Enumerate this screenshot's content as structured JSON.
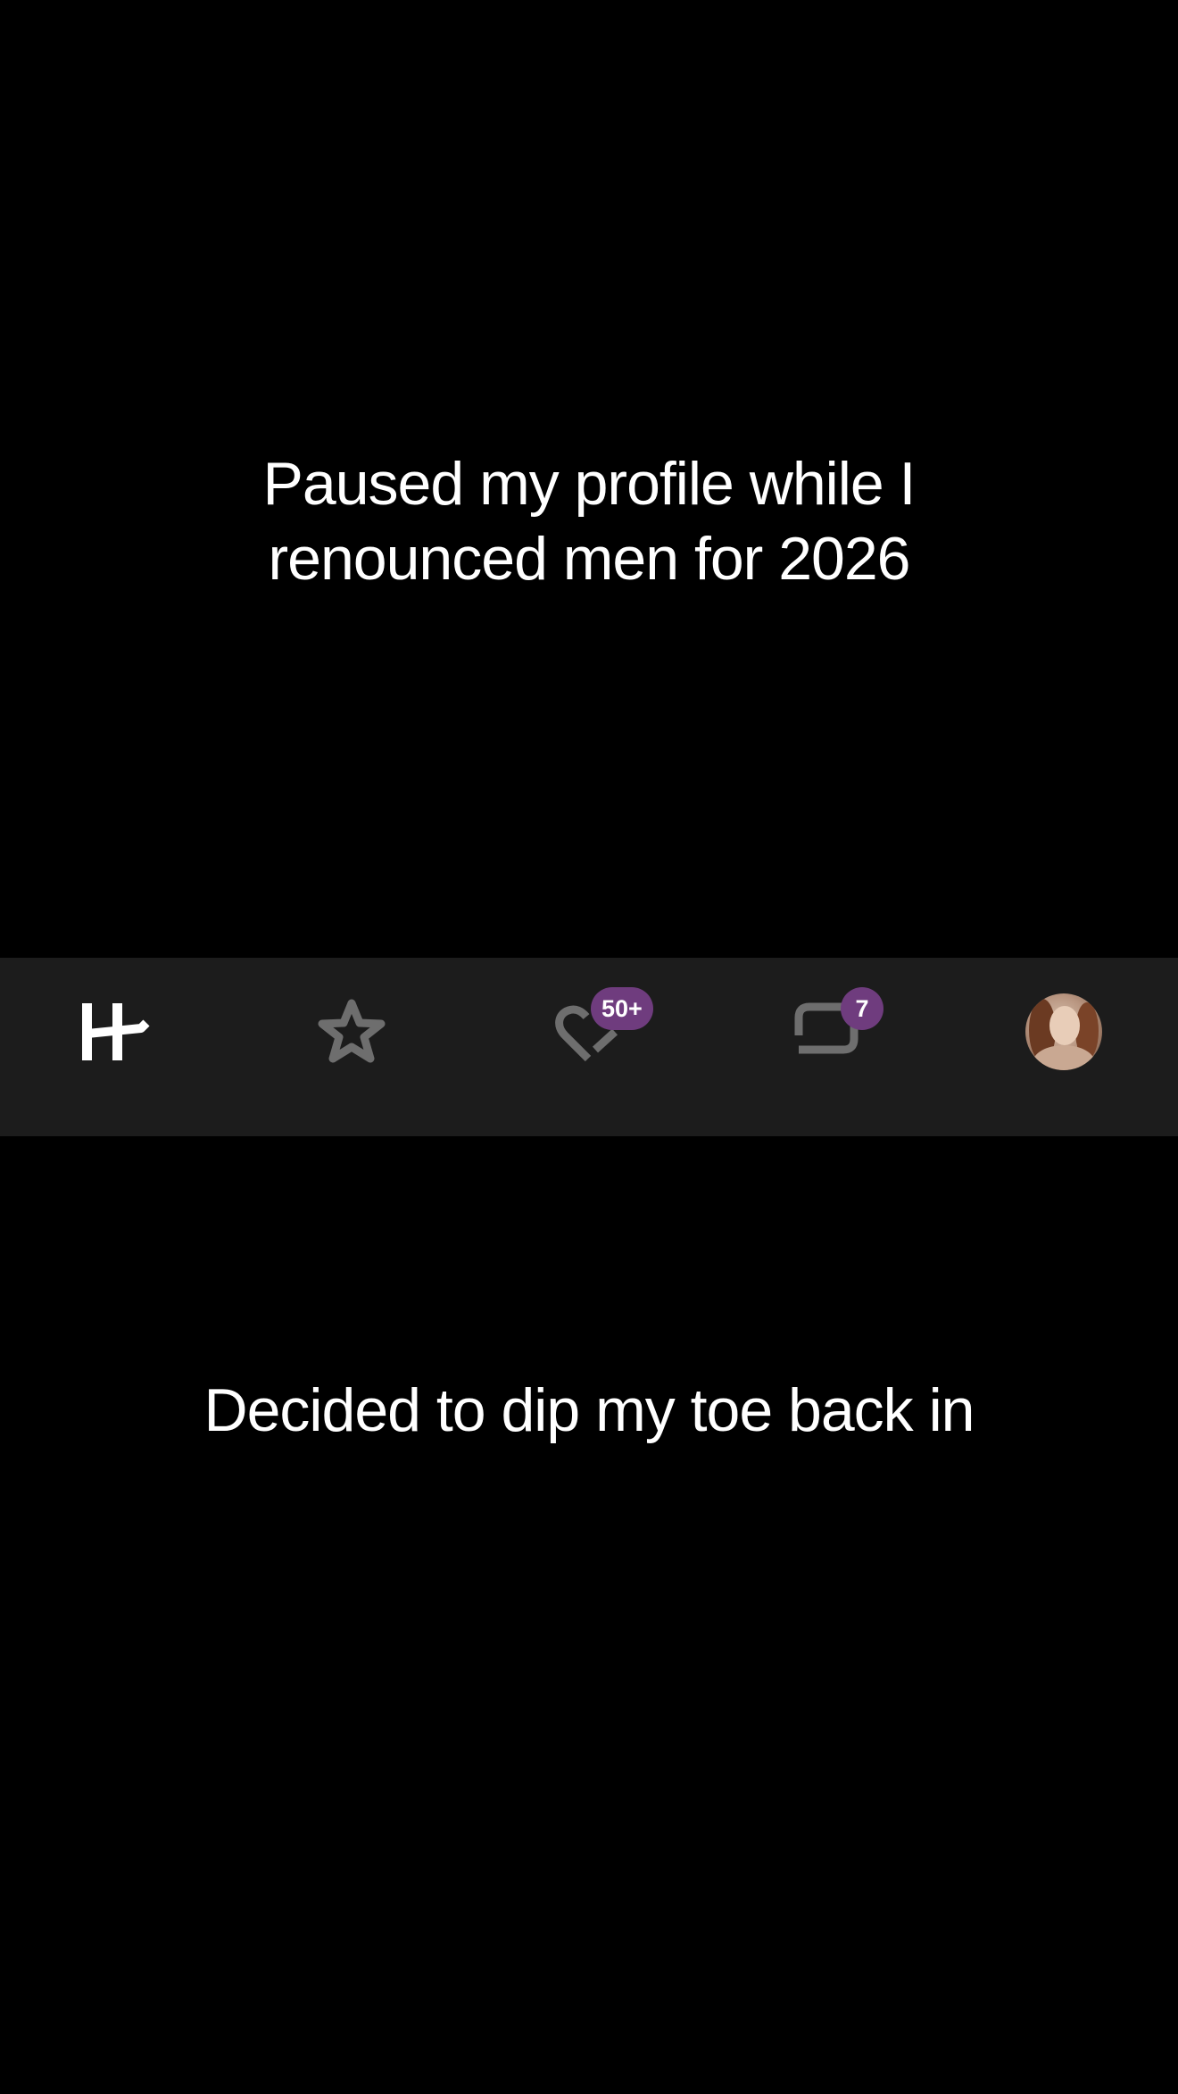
{
  "caption_top": {
    "lines": [
      "Paused my profile while I",
      "renounced men for 2026"
    ]
  },
  "caption_bottom": {
    "text": "Decided to dip my toe back in"
  },
  "tabbar": {
    "tabs": [
      {
        "name": "home",
        "icon": "hinge-logo-icon",
        "active": true
      },
      {
        "name": "standouts",
        "icon": "star-icon",
        "active": false
      },
      {
        "name": "likes-you",
        "icon": "heart-icon",
        "active": false,
        "badge": "50+"
      },
      {
        "name": "matches",
        "icon": "chat-icon",
        "active": false,
        "badge": "7"
      },
      {
        "name": "profile",
        "icon": "avatar-photo",
        "active": false
      }
    ]
  },
  "colors": {
    "background": "#000000",
    "tabbar_background": "#1c1c1c",
    "active_icon": "#ffffff",
    "inactive_icon": "#6e6e6e",
    "badge": "#6f3c7e"
  }
}
